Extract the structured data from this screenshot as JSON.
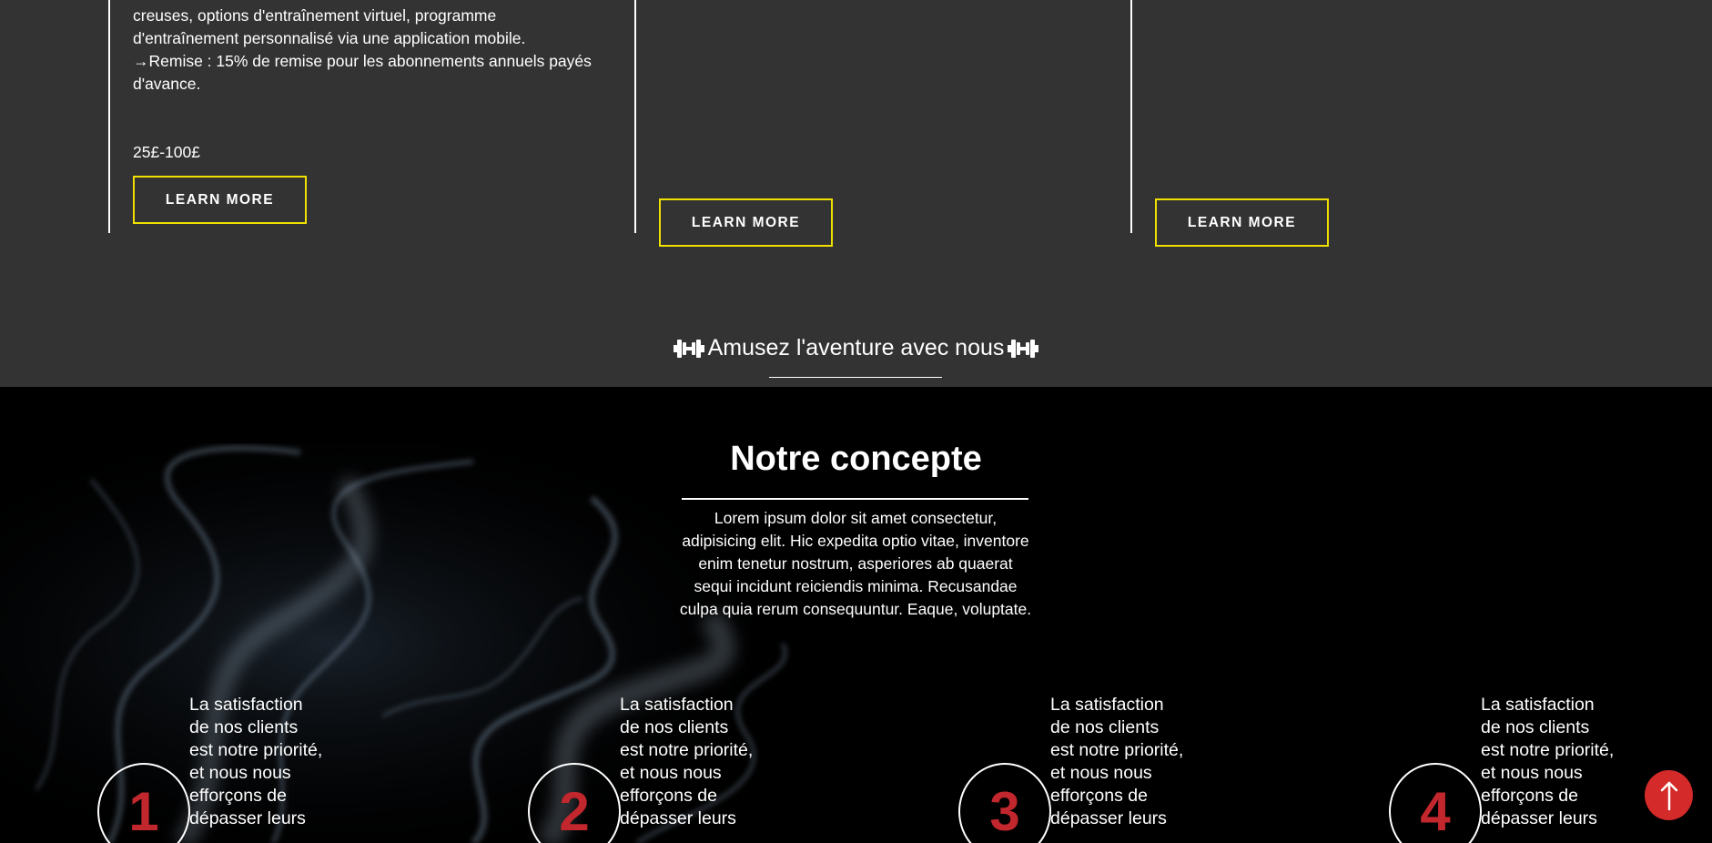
{
  "pricing": {
    "cards": [
      {
        "description_line1": "creuses, options d'entraînement virtuel, programme",
        "description_line2": "d'entraînement personnalisé via une application mobile.",
        "description_line3": "→Remise : 15% de remise pour les abonnements annuels payés",
        "description_line4": "d'avance.",
        "price": "25£-100£",
        "button_label": "LEARN MORE"
      },
      {
        "button_label": "LEARN MORE"
      },
      {
        "button_label": "LEARN MORE"
      }
    ],
    "adventure_heading": "Amusez l'aventure avec nous"
  },
  "concept": {
    "title": "Notre concepte",
    "text": "Lorem ipsum dolor sit amet consectetur, adipisicing elit. Hic expedita optio vitae, inventore enim tenetur nostrum, asperiores ab quaerat sequi incidunt reiciendis minima. Recusandae culpa quia rerum consequuntur. Eaque, voluptate.",
    "steps": [
      {
        "number": "1",
        "text": "La satisfaction de nos clients est notre priorité, et nous nous efforçons de dépasser leurs"
      },
      {
        "number": "2",
        "text": "La satisfaction de nos clients est notre priorité, et nous nous efforçons de dépasser leurs"
      },
      {
        "number": "3",
        "text": "La satisfaction de nos clients est notre priorité, et nous nous efforçons de dépasser leurs"
      },
      {
        "number": "4",
        "text": "La satisfaction de nos clients est notre priorité, et nous nous efforçons de dépasser leurs"
      }
    ]
  },
  "colors": {
    "pricing_background": "#333333",
    "button_border": "#f0e000",
    "accent_red": "#c1272d",
    "scroll_top_button": "#d42a2a"
  },
  "icons": {
    "heading_icon": "dumbbell-icon",
    "scroll_top_icon": "arrow-up-icon"
  }
}
